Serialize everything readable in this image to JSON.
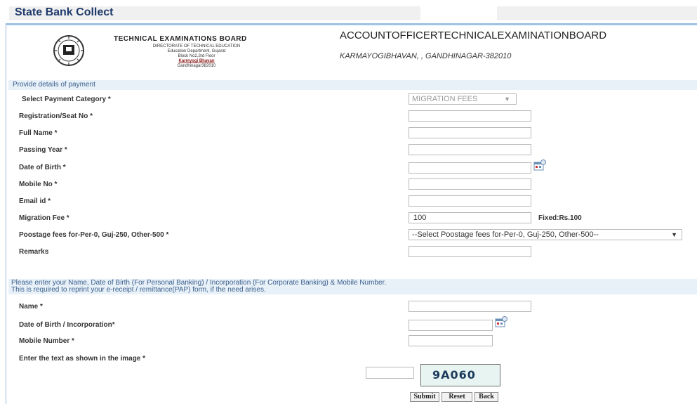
{
  "app": {
    "title": "State Bank Collect"
  },
  "header": {
    "org_name": "TECHNICAL EXAMINATIONS BOARD",
    "org_lines": [
      "DIRECTORATE OF TECHNICAL EDUCATION",
      "Education Department, Gujarat",
      "Block No2,3rd Floor",
      "Karmyogi Bhavan",
      "Gandhinagar382010"
    ],
    "account_title": "ACCOUNTOFFICERTECHNICALEXAMINATIONBOARD",
    "address": "KARMAYOGIBHAVAN, , GANDHINAGAR-382010"
  },
  "payment": {
    "section_title": "Provide details of payment",
    "category_label": "Select Payment Category *",
    "category_value": "MIGRATION FEES",
    "fields": [
      {
        "label": "Registration/Seat No *",
        "value": ""
      },
      {
        "label": "Full Name *",
        "value": ""
      },
      {
        "label": "Passing Year *",
        "value": ""
      },
      {
        "label": "Date of Birth *",
        "value": ""
      },
      {
        "label": "Mobile No *",
        "value": ""
      },
      {
        "label": "Email id *",
        "value": ""
      },
      {
        "label": "Migration Fee *",
        "value": "100"
      },
      {
        "label": "Poostage fees for-Per-0, Guj-250, Other-500 *",
        "value": ""
      },
      {
        "label": "Remarks",
        "value": ""
      }
    ],
    "fixed_text": "Fixed:Rs.100",
    "postage_select": "--Select Poostage fees for-Per-0, Guj-250, Other-500--"
  },
  "reprint": {
    "note_line1": "Please enter your Name, Date of Birth (For Personal Banking) / Incorporation (For Corporate Banking)  & Mobile Number.",
    "note_line2": "This is required to reprint your e-receipt / remittance(PAP) form, if the need arises.",
    "name_label": "Name *",
    "dob_label": "Date of Birth / Incorporation*",
    "mobile_label": "Mobile Number *",
    "captcha_label": "Enter the text as shown in the image *",
    "captcha_text": "9A060"
  },
  "buttons": {
    "submit": "Submit",
    "reset": "Reset",
    "back": "Back"
  },
  "icons": {
    "calendar": "calendar-icon",
    "seal": "board-seal-icon",
    "dropdown": "triangle-down-icon"
  }
}
